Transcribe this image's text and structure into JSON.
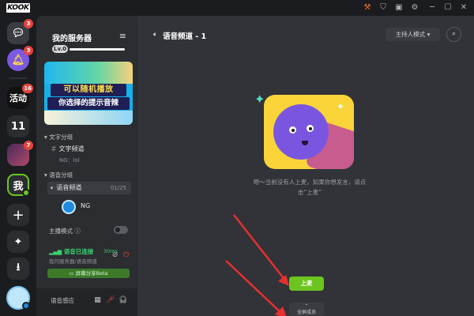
{
  "app": {
    "logo_text": "KOOK"
  },
  "window_controls": [
    "hammer-icon",
    "shield-icon",
    "gift-icon",
    "settings-icon",
    "minimize-icon",
    "maximize-icon",
    "close-icon"
  ],
  "rail": {
    "items": [
      {
        "name": "direct-messages",
        "icon": "chat-bubble-icon",
        "badge": "3"
      },
      {
        "name": "notifications",
        "icon": "bell-icon",
        "badge": "3"
      },
      {
        "name": "server-huodong",
        "text": "活动",
        "badge": "16"
      },
      {
        "name": "server-11",
        "text": "11",
        "badge": ""
      },
      {
        "name": "server-game",
        "text": "",
        "badge": "7"
      },
      {
        "name": "server-wo",
        "text": "我",
        "badge": ""
      }
    ],
    "add_icon": "plus-icon",
    "discover_icon": "sparkle-icon",
    "download_icon": "download-icon"
  },
  "server": {
    "name": "我的服务器",
    "level": "Lv.0",
    "banner": {
      "line1": "可以随机播放",
      "line2": "你选择的提示音辣"
    },
    "categories": [
      {
        "label": "文字分组",
        "channels": [
          {
            "name": "文字频道",
            "sub": "NG：lol"
          }
        ]
      },
      {
        "label": "语音分组",
        "channels": [
          {
            "name": "语音频道",
            "count": "01/25"
          }
        ]
      }
    ],
    "voice_user": "NG",
    "broadcast_mode_label": "主播模式",
    "connection": {
      "status": "语音已连接",
      "latency": "30ms",
      "path": "我的服务器/语音频道"
    },
    "share_screen_label": "屏幕分享Beta",
    "sound_label": "语音感应"
  },
  "main": {
    "channel_title": "语音频道 - 1",
    "host_button": "主持人模式",
    "empty_text": "嗯～当前没有人上麦，如果你想发言，请点击“上麦”",
    "up_mic_button": "上麦",
    "screen_button_label": "全屏成员"
  },
  "colors": {
    "accent_green": "#6cc51f",
    "badge_red": "#e3463f",
    "connected_green": "#3bd16f"
  }
}
